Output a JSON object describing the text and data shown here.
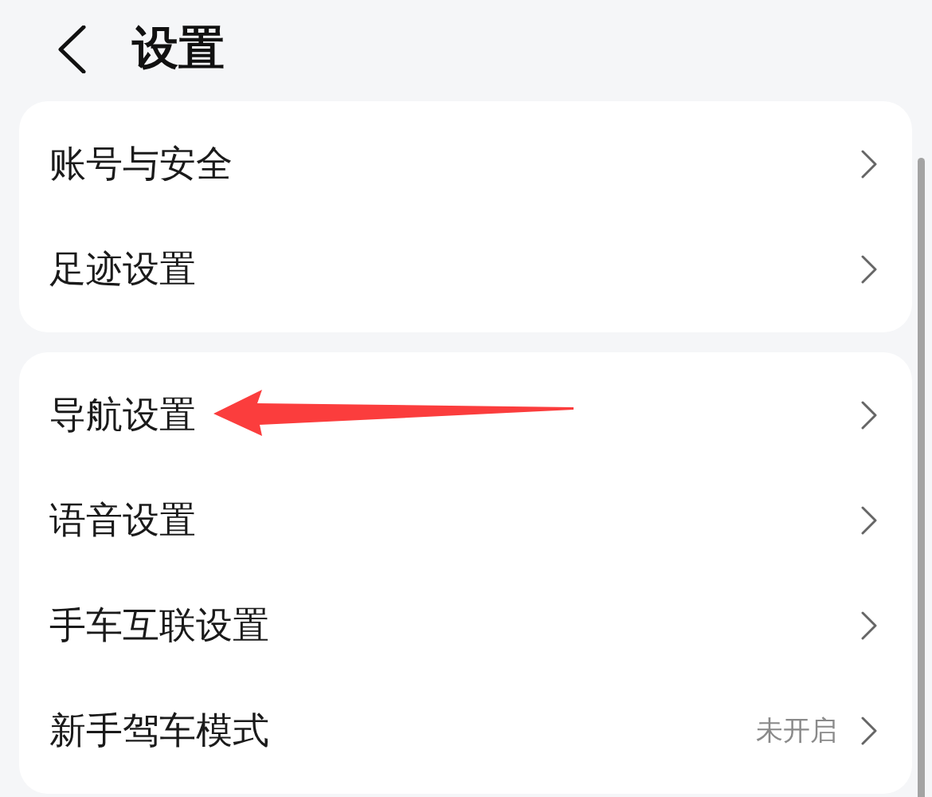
{
  "header": {
    "title": "设置"
  },
  "groups": [
    {
      "items": [
        {
          "label": "账号与安全",
          "annotated": false
        },
        {
          "label": "足迹设置",
          "annotated": false
        }
      ]
    },
    {
      "items": [
        {
          "label": "导航设置",
          "annotated": true
        },
        {
          "label": "语音设置",
          "annotated": false
        },
        {
          "label": "手车互联设置",
          "annotated": false
        },
        {
          "label": "新手驾车模式",
          "value": "未开启",
          "annotated": false
        }
      ]
    }
  ]
}
